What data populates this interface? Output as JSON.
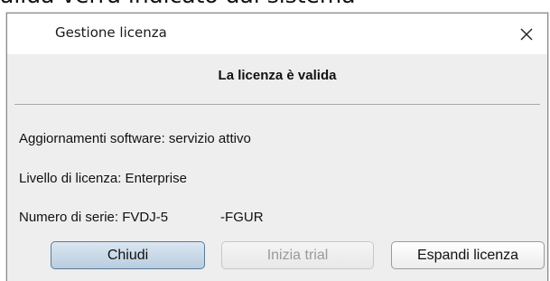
{
  "document": {
    "fragment_text": "alida verrà indicato dal sistema"
  },
  "window": {
    "title": "Gestione licenza",
    "close_icon": "close-icon"
  },
  "content": {
    "headline": "La licenza è valida",
    "info": {
      "updates": "Aggiornamenti software: servizio attivo",
      "level": "Livello di licenza: Enterprise",
      "serial_prefix": "Numero di serie: FVDJ-5",
      "serial_suffix": "-FGUR"
    }
  },
  "buttons": {
    "close": "Chiudi",
    "trial": "Inizia trial",
    "expand": "Espandi licenza"
  },
  "colors": {
    "primary_button": "#b9cde0",
    "disabled_text": "#9a9a9a",
    "dialog_bg": "#eeeeee"
  }
}
